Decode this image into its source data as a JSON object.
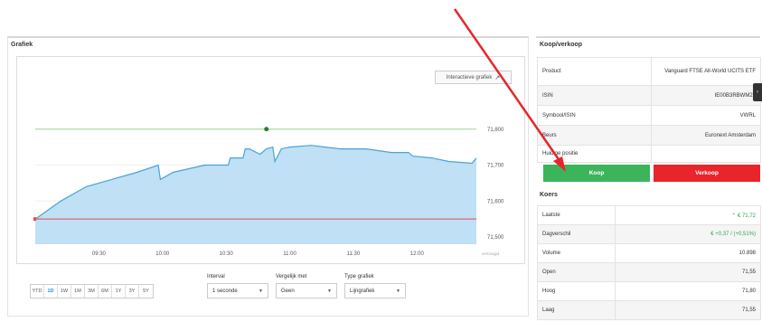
{
  "grafiek": {
    "title": "Grafiek",
    "interactive_label": "Interactieve grafiek",
    "watermark": "vertraagd",
    "time_labels": [
      "09:30",
      "10:00",
      "10:30",
      "11:00",
      "11:30",
      "12:00"
    ],
    "price_labels": [
      "71,800",
      "71,700",
      "71,600",
      "71,500"
    ],
    "ranges": [
      "YTD",
      "1D",
      "1W",
      "1M",
      "3M",
      "6M",
      "1Y",
      "3Y",
      "5Y"
    ],
    "active_range": "1D",
    "interval_label": "Interval",
    "interval_value": "1 seconde",
    "vergelijk_label": "Vergelijk met",
    "vergelijk_value": "Geen",
    "type_label": "Type grafiek",
    "type_value": "Lijngrafiek",
    "colors": {
      "line": "#4aa3d8",
      "fill": "#bfe0f5",
      "ref_low": "#e84c4c",
      "ref_high": "#9fd69a",
      "marker": "#2e7d32"
    }
  },
  "koopverkoop": {
    "title": "Koop/verkoop",
    "rows": [
      {
        "label": "Product",
        "value": "Vanguard FTSE All-World UCITS ETF"
      },
      {
        "label": "ISIN",
        "value": "IE00B3RBWM25"
      },
      {
        "label": "Symbool/ISIN",
        "value": "VWRL"
      },
      {
        "label": "Beurs",
        "value": "Euronext Amsterdam"
      },
      {
        "label": "Huidige positie",
        "value": ""
      }
    ],
    "buy_label": "Koop",
    "sell_label": "Verkoop"
  },
  "koers": {
    "title": "Koers",
    "rows": [
      {
        "label": "Laatste",
        "value": "€ 71,72"
      },
      {
        "label": "Dagverschil",
        "value": "€ +0,37 / (+0,51%)"
      },
      {
        "label": "Volume",
        "value": "10.898"
      },
      {
        "label": "Open",
        "value": "71,55"
      },
      {
        "label": "Hoog",
        "value": "71,80"
      },
      {
        "label": "Laag",
        "value": "71,55"
      }
    ]
  },
  "chart_data": {
    "type": "area",
    "x": [
      "09:00",
      "09:12",
      "09:24",
      "09:36",
      "09:48",
      "09:58",
      "09:59",
      "10:05",
      "10:20",
      "10:31",
      "10:32",
      "10:36",
      "10:38",
      "10:39",
      "10:41",
      "10:46",
      "10:49",
      "10:52",
      "10:53",
      "10:56",
      "11:00",
      "11:10",
      "11:24",
      "11:36",
      "11:48",
      "11:56",
      "11:58",
      "12:07",
      "12:15",
      "12:26",
      "12:28"
    ],
    "y": [
      71.55,
      71.6,
      71.64,
      71.66,
      71.68,
      71.7,
      71.66,
      71.68,
      71.7,
      71.7,
      71.72,
      71.72,
      71.72,
      71.745,
      71.745,
      71.73,
      71.745,
      71.75,
      71.71,
      71.745,
      71.75,
      71.755,
      71.745,
      71.745,
      71.735,
      71.735,
      71.725,
      71.72,
      71.71,
      71.705,
      71.72
    ],
    "ylim": [
      71.48,
      71.9
    ],
    "ref_lines": [
      71.55,
      71.8
    ],
    "high_point": {
      "x": "10:49",
      "y": 71.8
    }
  }
}
